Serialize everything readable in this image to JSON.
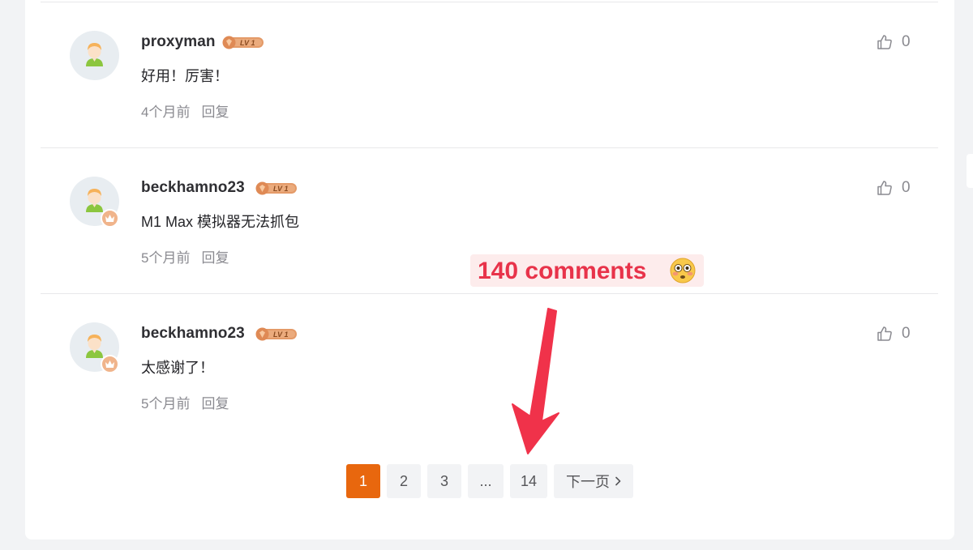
{
  "comments": [
    {
      "username": "proxyman",
      "level": "LV 1",
      "content": "好用！厉害！",
      "time": "4个月前",
      "reply": "回复",
      "likes": "0",
      "has_crown": false
    },
    {
      "username": "beckhamno23",
      "level": "LV 1",
      "content": "M1 Max 模拟器无法抓包",
      "time": "5个月前",
      "reply": "回复",
      "likes": "0",
      "has_crown": true
    },
    {
      "username": "beckhamno23",
      "level": "LV 1",
      "content": "太感谢了！",
      "time": "5个月前",
      "reply": "回复",
      "likes": "0",
      "has_crown": true
    }
  ],
  "annotation": {
    "text": "140 comments",
    "emoji": "flushed-face"
  },
  "pagination": {
    "pages": [
      "1",
      "2",
      "3",
      "...",
      "14"
    ],
    "active": "1",
    "next_label": "下一页"
  },
  "colors": {
    "accent": "#e8670e",
    "annotation": "#e8334a",
    "level_badge": "#e49a68"
  },
  "icons": {
    "like": "thumbs-up-icon",
    "next": "chevron-right-icon",
    "crown": "crown-icon",
    "level": "level-badge-icon",
    "avatar": "default-avatar-icon"
  }
}
